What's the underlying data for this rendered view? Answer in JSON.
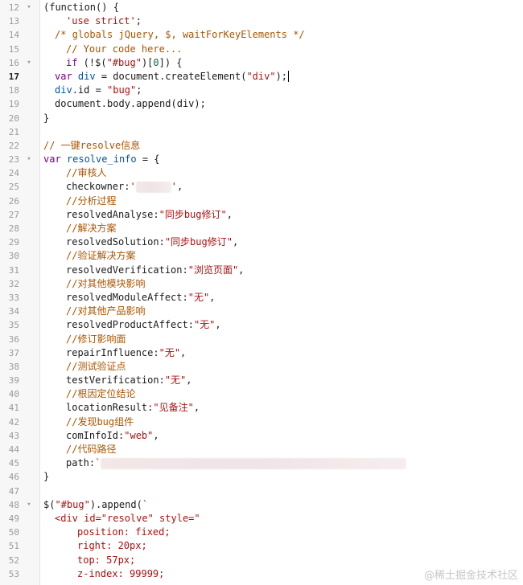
{
  "editor": {
    "active_line": 17,
    "lines": [
      {
        "n": "12",
        "fold": "▾",
        "indent": 0,
        "parts": [
          [
            "p",
            "(function() {"
          ]
        ]
      },
      {
        "n": "13",
        "indent": 2,
        "parts": [
          [
            "s",
            "'use strict'"
          ],
          [
            "p",
            ";"
          ]
        ]
      },
      {
        "n": "14",
        "indent": 1,
        "parts": [
          [
            "c",
            "/* globals jQuery, $, waitForKeyElements */"
          ]
        ]
      },
      {
        "n": "15",
        "indent": 2,
        "parts": [
          [
            "c",
            "// Your code here..."
          ]
        ]
      },
      {
        "n": "16",
        "fold": "▾",
        "indent": 2,
        "parts": [
          [
            "k",
            "if"
          ],
          [
            "p",
            " (!$("
          ],
          [
            "s",
            "\"#bug\""
          ],
          [
            "p",
            ")["
          ],
          [
            "m",
            "0"
          ],
          [
            "p",
            "]) {"
          ]
        ]
      },
      {
        "n": "17",
        "indent": 1,
        "parts": [
          [
            "k",
            "var"
          ],
          [
            "p",
            " "
          ],
          [
            "v",
            "div"
          ],
          [
            "p",
            " = document.createElement("
          ],
          [
            "s",
            "\"div\""
          ],
          [
            "p",
            ");"
          ]
        ],
        "cursor": true
      },
      {
        "n": "18",
        "indent": 1,
        "parts": [
          [
            "v",
            "div"
          ],
          [
            "p",
            ".id = "
          ],
          [
            "s",
            "\"bug\""
          ],
          [
            "p",
            ";"
          ]
        ]
      },
      {
        "n": "19",
        "indent": 1,
        "parts": [
          [
            "p",
            "document.body.append(div);"
          ]
        ]
      },
      {
        "n": "20",
        "indent": 0,
        "parts": [
          [
            "p",
            "}"
          ]
        ]
      },
      {
        "n": "21",
        "indent": 0,
        "parts": []
      },
      {
        "n": "22",
        "indent": 0,
        "parts": [
          [
            "c",
            "// 一键resolve信息"
          ]
        ]
      },
      {
        "n": "23",
        "fold": "▾",
        "indent": 0,
        "parts": [
          [
            "k",
            "var"
          ],
          [
            "p",
            " "
          ],
          [
            "v",
            "resolve_info"
          ],
          [
            "p",
            " = {"
          ]
        ]
      },
      {
        "n": "24",
        "indent": 2,
        "parts": [
          [
            "c",
            "//审核人"
          ]
        ]
      },
      {
        "n": "25",
        "indent": 2,
        "parts": [
          [
            "p",
            "checkowner:"
          ],
          [
            "s",
            "'"
          ],
          [
            "b",
            "44"
          ],
          [
            "s",
            "'"
          ],
          [
            "p",
            ","
          ]
        ]
      },
      {
        "n": "26",
        "indent": 2,
        "parts": [
          [
            "c",
            "//分析过程"
          ]
        ]
      },
      {
        "n": "27",
        "indent": 2,
        "parts": [
          [
            "p",
            "resolvedAnalyse:"
          ],
          [
            "s",
            "\"同步bug修订\""
          ],
          [
            "p",
            ","
          ]
        ]
      },
      {
        "n": "28",
        "indent": 2,
        "parts": [
          [
            "c",
            "//解决方案"
          ]
        ]
      },
      {
        "n": "29",
        "indent": 2,
        "parts": [
          [
            "p",
            "resolvedSolution:"
          ],
          [
            "s",
            "\"同步bug修订\""
          ],
          [
            "p",
            ","
          ]
        ]
      },
      {
        "n": "30",
        "indent": 2,
        "parts": [
          [
            "c",
            "//验证解决方案"
          ]
        ]
      },
      {
        "n": "31",
        "indent": 2,
        "parts": [
          [
            "p",
            "resolvedVerification:"
          ],
          [
            "s",
            "\"浏览页面\""
          ],
          [
            "p",
            ","
          ]
        ]
      },
      {
        "n": "32",
        "indent": 2,
        "parts": [
          [
            "c",
            "//对其他模块影响"
          ]
        ]
      },
      {
        "n": "33",
        "indent": 2,
        "parts": [
          [
            "p",
            "resolvedModuleAffect:"
          ],
          [
            "s",
            "\"无\""
          ],
          [
            "p",
            ","
          ]
        ]
      },
      {
        "n": "34",
        "indent": 2,
        "parts": [
          [
            "c",
            "//对其他产品影响"
          ]
        ]
      },
      {
        "n": "35",
        "indent": 2,
        "parts": [
          [
            "p",
            "resolvedProductAffect:"
          ],
          [
            "s",
            "\"无\""
          ],
          [
            "p",
            ","
          ]
        ]
      },
      {
        "n": "36",
        "indent": 2,
        "parts": [
          [
            "c",
            "//修订影响面"
          ]
        ]
      },
      {
        "n": "37",
        "indent": 2,
        "parts": [
          [
            "p",
            "repairInfluence:"
          ],
          [
            "s",
            "\"无\""
          ],
          [
            "p",
            ","
          ]
        ]
      },
      {
        "n": "38",
        "indent": 2,
        "parts": [
          [
            "c",
            "//测试验证点"
          ]
        ]
      },
      {
        "n": "39",
        "indent": 2,
        "parts": [
          [
            "p",
            "testVerification:"
          ],
          [
            "s",
            "\"无\""
          ],
          [
            "p",
            ","
          ]
        ]
      },
      {
        "n": "40",
        "indent": 2,
        "parts": [
          [
            "c",
            "//根因定位结论"
          ]
        ]
      },
      {
        "n": "41",
        "indent": 2,
        "parts": [
          [
            "p",
            "locationResult:"
          ],
          [
            "s",
            "\"见备注\""
          ],
          [
            "p",
            ","
          ]
        ]
      },
      {
        "n": "42",
        "indent": 2,
        "parts": [
          [
            "c",
            "//发现bug组件"
          ]
        ]
      },
      {
        "n": "43",
        "indent": 2,
        "parts": [
          [
            "p",
            "comInfoId:"
          ],
          [
            "s",
            "\"web\""
          ],
          [
            "p",
            ","
          ]
        ]
      },
      {
        "n": "44",
        "indent": 2,
        "parts": [
          [
            "c",
            "//代码路径"
          ]
        ]
      },
      {
        "n": "45",
        "indent": 2,
        "parts": [
          [
            "p",
            "path:"
          ],
          [
            "s",
            "`"
          ],
          [
            "b",
            "380"
          ]
        ]
      },
      {
        "n": "46",
        "indent": 0,
        "parts": [
          [
            "p",
            "}"
          ]
        ]
      },
      {
        "n": "47",
        "indent": 0,
        "parts": []
      },
      {
        "n": "48",
        "fold": "▾",
        "indent": 0,
        "parts": [
          [
            "p",
            "$("
          ],
          [
            "s",
            "\"#bug\""
          ],
          [
            "p",
            ").append("
          ],
          [
            "s",
            "`"
          ]
        ]
      },
      {
        "n": "49",
        "indent": 1,
        "parts": [
          [
            "s",
            "<div id=\"resolve\" style=\""
          ]
        ]
      },
      {
        "n": "50",
        "indent": 3,
        "parts": [
          [
            "s",
            "position: fixed;"
          ]
        ]
      },
      {
        "n": "51",
        "indent": 3,
        "parts": [
          [
            "s",
            "right: 20px;"
          ]
        ]
      },
      {
        "n": "52",
        "indent": 3,
        "parts": [
          [
            "s",
            "top: 57px;"
          ]
        ]
      },
      {
        "n": "53",
        "indent": 3,
        "parts": [
          [
            "s",
            "z-index: 99999;"
          ]
        ]
      }
    ]
  },
  "watermark": "@稀土掘金技术社区"
}
